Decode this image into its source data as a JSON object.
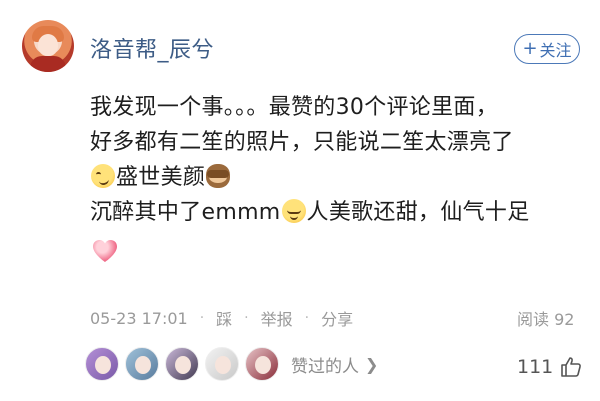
{
  "comment": {
    "username": "洛音帮_辰兮",
    "follow_label": "关注",
    "lines": [
      "我发现一个事。。。最赞的30个评论里面，",
      "好多都有二笙的照片，只能说二笙太漂亮了",
      "盛世美颜",
      "沉醉其中了emmm",
      "人美歌还甜，仙气十足"
    ],
    "emoji": [
      "smirk-emoji",
      "see-no-evil-monkey-emoji",
      "pensive-emoji",
      "heart-emoji"
    ],
    "meta": {
      "timestamp": "05-23 17:01",
      "actions": [
        "踩",
        "举报",
        "分享"
      ],
      "read_label": "阅读 92"
    },
    "likers": {
      "label": "赞过的人",
      "count_avatars": 5
    },
    "like_count": "111"
  },
  "colors": {
    "username": "#3d5c86",
    "follow_accent": "#4c79b8",
    "meta_text": "#9a9a9a"
  }
}
